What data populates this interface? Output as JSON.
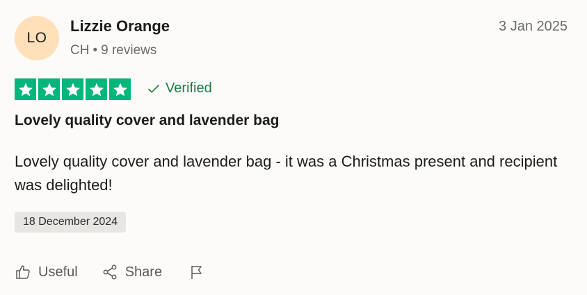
{
  "reviewer": {
    "initials": "LO",
    "name": "Lizzie Orange",
    "country": "CH",
    "separator": "•",
    "reviews": "9 reviews"
  },
  "review": {
    "date": "3 Jan 2025",
    "rating": 5,
    "rating_max": 5,
    "star_color": "#00b67a",
    "verified_label": "Verified",
    "title": "Lovely quality cover and lavender bag",
    "body": "Lovely quality cover and lavender bag - it was a Christmas present and recipient was delighted!",
    "experience_date": "18 December 2024"
  },
  "actions": {
    "useful_label": "Useful",
    "share_label": "Share",
    "useful_icon": "thumbs-up-icon",
    "share_icon": "share-icon",
    "report_icon": "flag-icon"
  }
}
